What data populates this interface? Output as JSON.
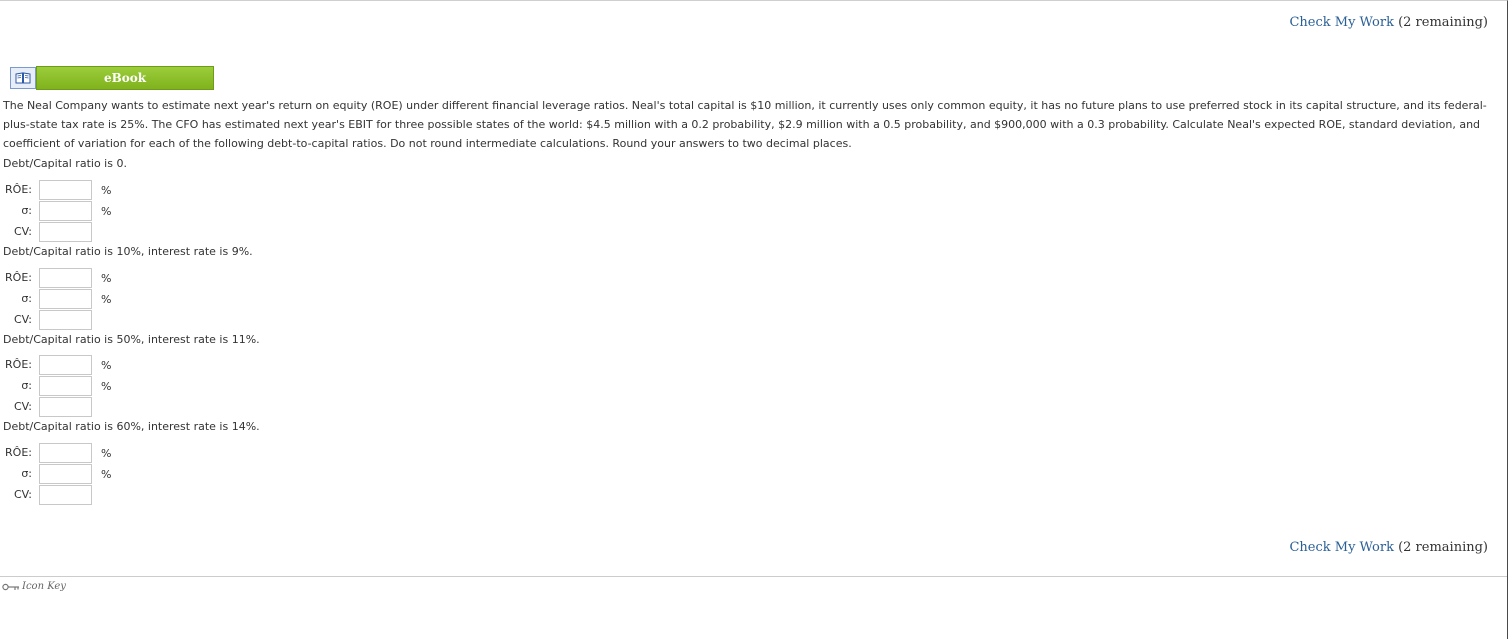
{
  "header": {
    "check_link": "Check My Work",
    "check_remaining": " (2 remaining)"
  },
  "ebook": {
    "label": "eBook"
  },
  "question": {
    "text": "The Neal Company wants to estimate next year's return on equity (ROE) under different financial leverage ratios. Neal's total capital is $10 million, it currently uses only common equity, it has no future plans to use preferred stock in its capital structure, and its federal-plus-state tax rate is 25%. The CFO has estimated next year's EBIT for three possible states of the world: $4.5 million with a 0.2 probability, $2.9 million with a 0.5 probability, and $900,000 with a 0.3 probability. Calculate Neal's expected ROE, standard deviation, and coefficient of variation for each of the following debt-to-capital ratios. Do not round intermediate calculations. Round your answers to two decimal places."
  },
  "sections": [
    {
      "label": "Debt/Capital ratio is 0.",
      "roe_label": "RÔE:",
      "sigma_label": "σ:",
      "cv_label": "CV:",
      "roe_value": "",
      "sigma_value": "",
      "cv_value": "",
      "unit": "%"
    },
    {
      "label": "Debt/Capital ratio is 10%, interest rate is 9%.",
      "roe_label": "RÔE:",
      "sigma_label": "σ:",
      "cv_label": "CV:",
      "roe_value": "",
      "sigma_value": "",
      "cv_value": "",
      "unit": "%"
    },
    {
      "label": "Debt/Capital ratio is 50%, interest rate is 11%.",
      "roe_label": "RÔE:",
      "sigma_label": "σ:",
      "cv_label": "CV:",
      "roe_value": "",
      "sigma_value": "",
      "cv_value": "",
      "unit": "%"
    },
    {
      "label": "Debt/Capital ratio is 60%, interest rate is 14%.",
      "roe_label": "RÔE:",
      "sigma_label": "σ:",
      "cv_label": "CV:",
      "roe_value": "",
      "sigma_value": "",
      "cv_value": "",
      "unit": "%"
    }
  ],
  "footer": {
    "check_link": "Check My Work",
    "check_remaining": " (2 remaining)",
    "icon_key_label": "Icon Key",
    "icon_key_icon": "key-icon"
  },
  "icons": {
    "ebook": "book-icon"
  },
  "colors": {
    "link": "#2a5f96",
    "ebook_green": "#8cc12b"
  }
}
